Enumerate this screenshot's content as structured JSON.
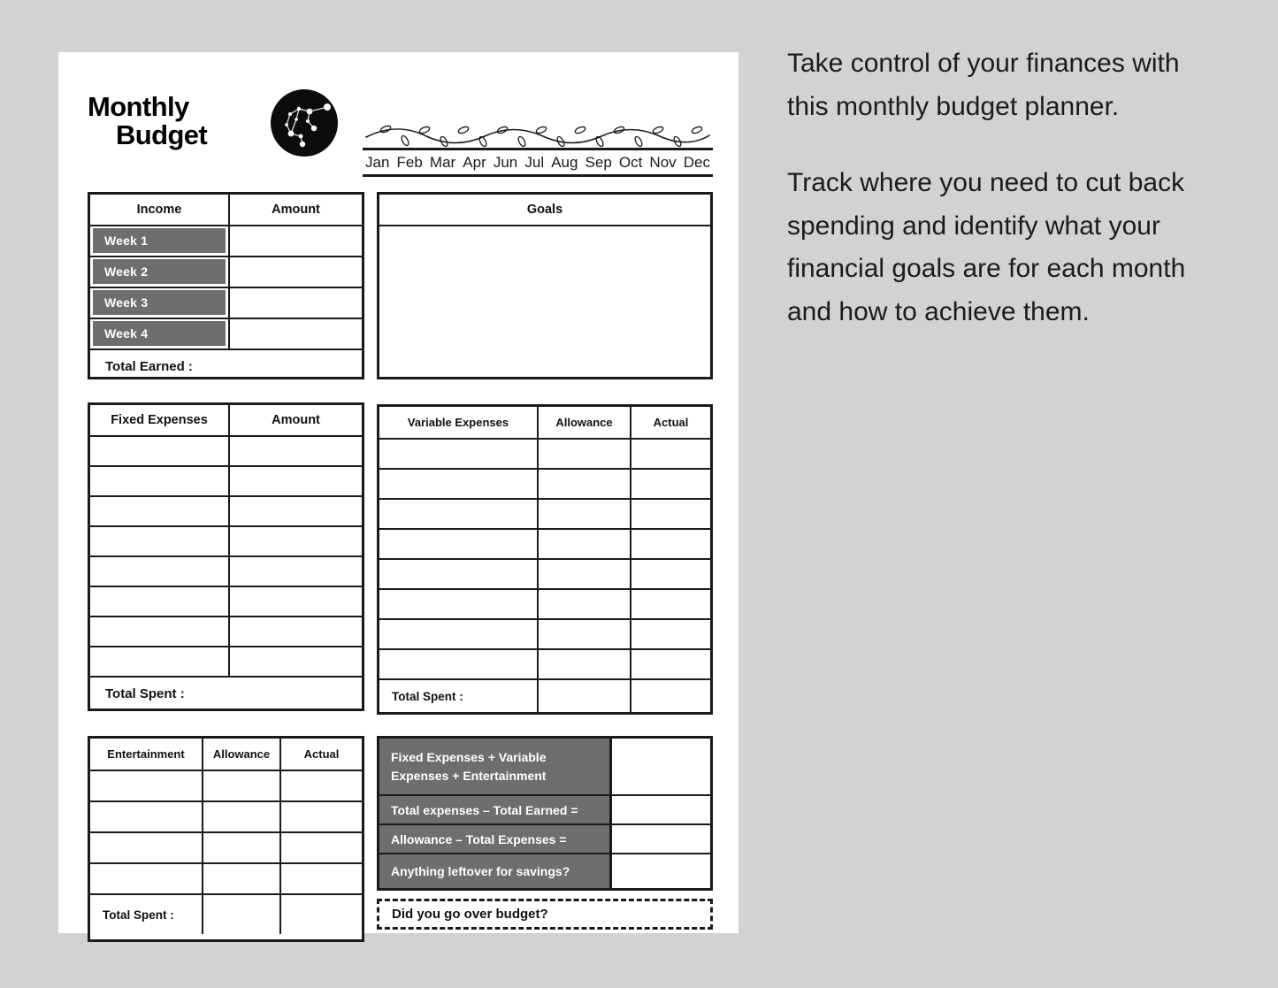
{
  "page": {
    "brand_line1": "Monthly",
    "brand_line2": "Budget",
    "logo_icon": "constellation-circle-icon",
    "vine_icon": "vine-divider-icon"
  },
  "months": [
    "Jan",
    "Feb",
    "Mar",
    "Apr",
    "Jun",
    "Jul",
    "Aug",
    "Sep",
    "Oct",
    "Nov",
    "Dec"
  ],
  "income": {
    "headers": [
      "Income",
      "Amount"
    ],
    "weeks": [
      "Week 1",
      "Week 2",
      "Week 3",
      "Week 4"
    ],
    "total_label": "Total Earned :"
  },
  "goals": {
    "header": "Goals"
  },
  "fixed_expenses": {
    "headers": [
      "Fixed Expenses",
      "Amount"
    ],
    "row_count": 8,
    "total_label": "Total Spent :"
  },
  "variable_expenses": {
    "headers": [
      "Variable Expenses",
      "Allowance",
      "Actual"
    ],
    "row_count": 8,
    "total_label": "Total Spent :"
  },
  "entertainment": {
    "headers": [
      "Entertainment",
      "Allowance",
      "Actual"
    ],
    "row_count": 4,
    "total_label": "Total Spent :"
  },
  "summary": {
    "rows": [
      {
        "label": "Fixed Expenses +\nVariable Expenses +\nEntertainment",
        "equals": "="
      },
      {
        "label": "Total expenses – Total Earned =",
        "equals": ""
      },
      {
        "label": "Allowance – Total Expenses =",
        "equals": ""
      },
      {
        "label": "Anything leftover for savings?",
        "equals": ""
      }
    ],
    "over_budget_label": "Did you go over budget?"
  },
  "promo": {
    "paragraph1": "Take control of your finances with this monthly budget planner.",
    "paragraph2": "Track where you need to cut back spending and identify what your financial goals are for each month and how to achieve them."
  },
  "colors": {
    "background": "#d2d2d2",
    "paper": "#ffffff",
    "ink": "#1a1a1a",
    "gray_fill": "#6e6e6e"
  }
}
